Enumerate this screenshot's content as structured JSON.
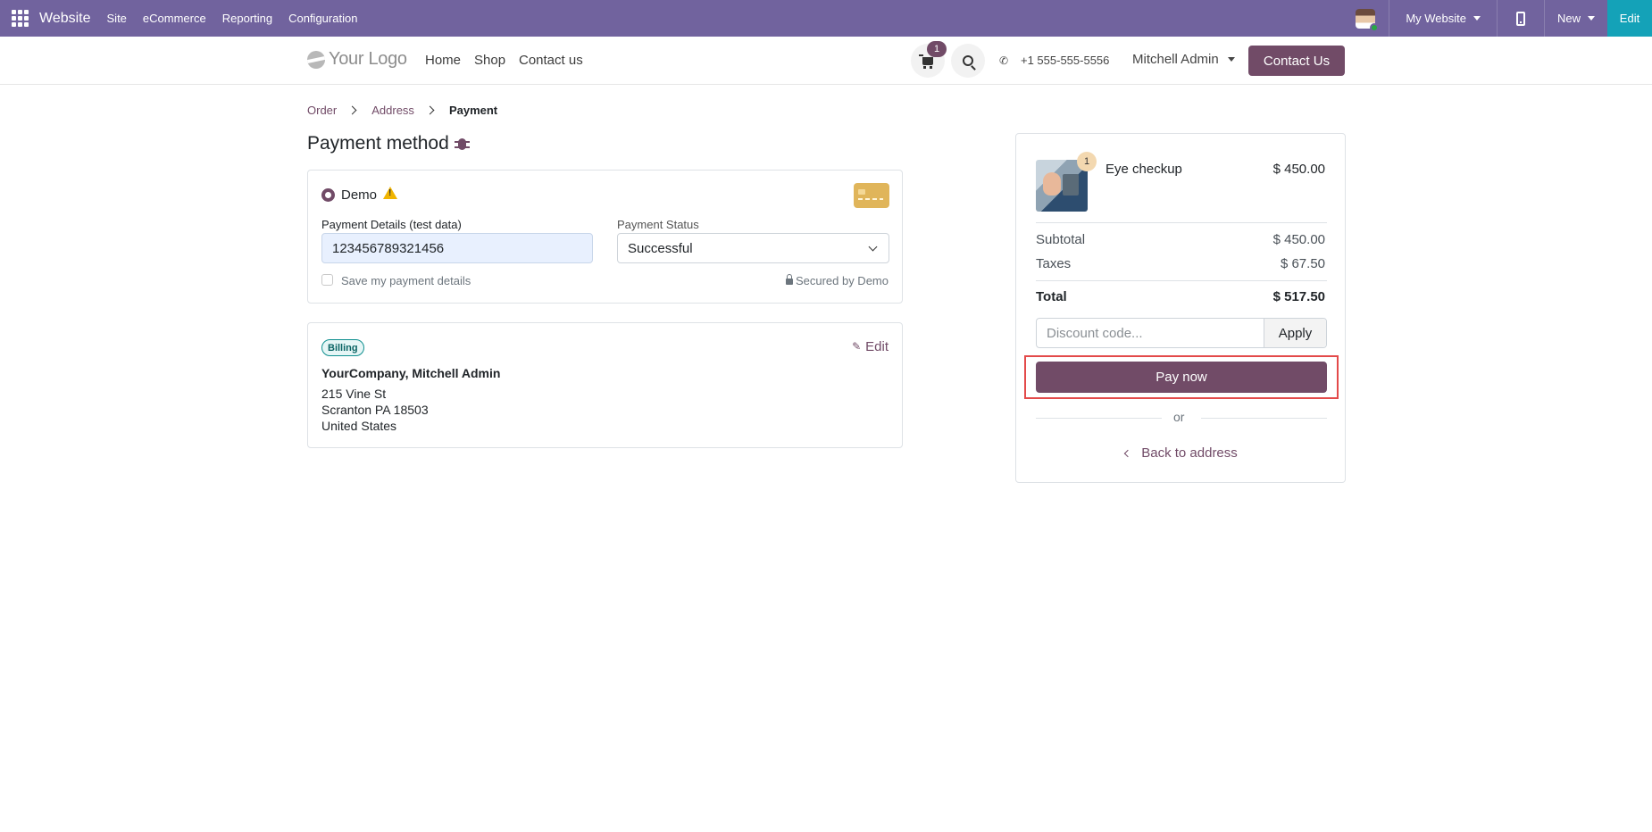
{
  "admin_bar": {
    "brand": "Website",
    "menu": [
      "Site",
      "eCommerce",
      "Reporting",
      "Configuration"
    ],
    "my_website": "My Website",
    "new_label": "New",
    "edit_label": "Edit"
  },
  "site_header": {
    "logo_text": "Your Logo",
    "nav": [
      "Home",
      "Shop",
      "Contact us"
    ],
    "cart_count": "1",
    "phone": "+1 555-555-5556",
    "user": "Mitchell Admin",
    "contact_button": "Contact Us"
  },
  "breadcrumb": {
    "items": [
      "Order",
      "Address",
      "Payment"
    ]
  },
  "page_title": "Payment method",
  "payment": {
    "method_name": "Demo",
    "details_label": "Payment Details (test data)",
    "details_value": "123456789321456",
    "status_label": "Payment Status",
    "status_value": "Successful",
    "save_label": "Save my payment details",
    "secured_label": "Secured by Demo"
  },
  "billing": {
    "badge": "Billing",
    "edit_label": "Edit",
    "name": "YourCompany, Mitchell Admin",
    "address": [
      "215 Vine St",
      "Scranton PA 18503",
      "United States"
    ]
  },
  "summary": {
    "product_name": "Eye checkup",
    "product_qty": "1",
    "product_price": "$ 450.00",
    "subtotal_label": "Subtotal",
    "subtotal_value": "$ 450.00",
    "taxes_label": "Taxes",
    "taxes_value": "$ 67.50",
    "total_label": "Total",
    "total_value": "$ 517.50",
    "discount_placeholder": "Discount code...",
    "apply_label": "Apply",
    "pay_label": "Pay now",
    "or_label": "or",
    "back_label": "Back to address"
  },
  "colors": {
    "admin_bar": "#71639e",
    "brand_primary": "#714b67",
    "edit_accent": "#14a2b8",
    "highlight_outline": "#e34a4a"
  }
}
